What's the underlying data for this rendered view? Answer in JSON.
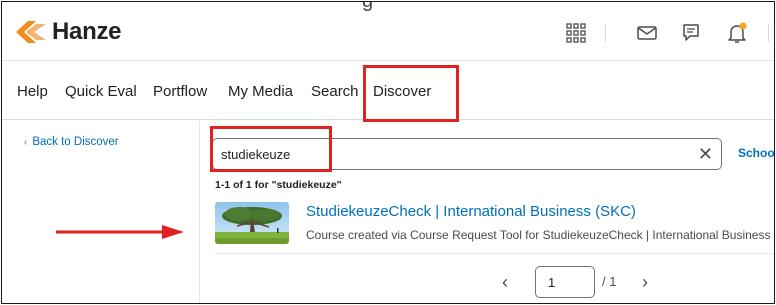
{
  "header": {
    "peek_text": "g",
    "brand": "Hanze",
    "icons": [
      "apps-grid-icon",
      "mail-icon",
      "chat-icon",
      "bell-icon",
      "more-icon"
    ],
    "notification_dot_color": "#f5a623"
  },
  "navbar": {
    "items": [
      "Help",
      "Quick Eval",
      "Portflow",
      "My Media",
      "Search",
      "Discover"
    ]
  },
  "sidebar": {
    "back_link": "Back to Discover"
  },
  "search": {
    "value": "studiekeuze",
    "clear_glyph": "✕",
    "filter_link": "School"
  },
  "results": {
    "count_text": "1-1 of 1 for \"studiekeuze\"",
    "items": [
      {
        "title": "StudiekeuzeCheck | International Business (SKC)",
        "description": "Course created via Course Request Tool for StudiekeuzeCheck | International Business (SKC)"
      }
    ]
  },
  "pagination": {
    "current_page": "1",
    "total": "/ 1"
  },
  "annotations": {
    "color": "#e0231f"
  },
  "colors": {
    "link": "#006fbf",
    "brand_orange": "#f28c1e"
  }
}
